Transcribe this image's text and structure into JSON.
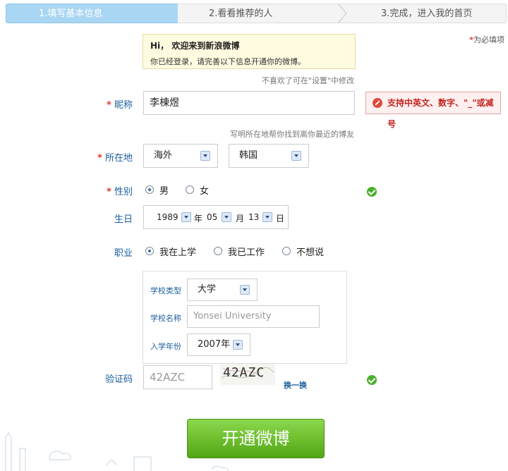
{
  "steps": [
    {
      "label": "1.填写基本信息",
      "active": true
    },
    {
      "label": "2.看看推荐的人",
      "active": false
    },
    {
      "label": "3.完成，进入我的首页",
      "active": false
    }
  ],
  "required_note": {
    "star": "*",
    "text": "为必填项"
  },
  "welcome": {
    "line1": "Hi， 欢迎来到新浪微博",
    "line2": "你已经登录，请完善以下信息开通你的微博。"
  },
  "hint_nickname": "不喜欢了可在\"设置\"中修改",
  "hint_location": "写明所在地帮你找到离你最近的博友",
  "nickname": {
    "star": "*",
    "label": "昵称",
    "value": "李棟煜",
    "error": "支持中英文、数字、\"_\"或减号"
  },
  "location": {
    "star": "*",
    "label": "所在地",
    "region": "海外",
    "country": "韩国"
  },
  "gender": {
    "star": "*",
    "label": "性别",
    "options": [
      "男",
      "女"
    ],
    "selected": "男"
  },
  "birthday": {
    "label": "生日",
    "year": "1989",
    "year_unit": "年",
    "month": "05",
    "month_unit": "月",
    "day": "13",
    "day_unit": "日"
  },
  "occupation": {
    "label": "职业",
    "options": [
      "我在上学",
      "我已工作",
      "不想说"
    ],
    "selected": "我在上学"
  },
  "school": {
    "type_label": "学校类型",
    "type_value": "大学",
    "name_label": "学校名称",
    "name_value": "Yonsei University",
    "year_label": "入学年份",
    "year_value": "2007年"
  },
  "captcha": {
    "label": "验证码",
    "value": "42AZC",
    "image_text": "42AZC",
    "refresh": "换一换"
  },
  "submit": "开通微博",
  "colors": {
    "accent": "#a9d6f3",
    "label_blue": "#1a5d9e",
    "submit_green": "#52a616",
    "error_red": "#c4241f"
  }
}
